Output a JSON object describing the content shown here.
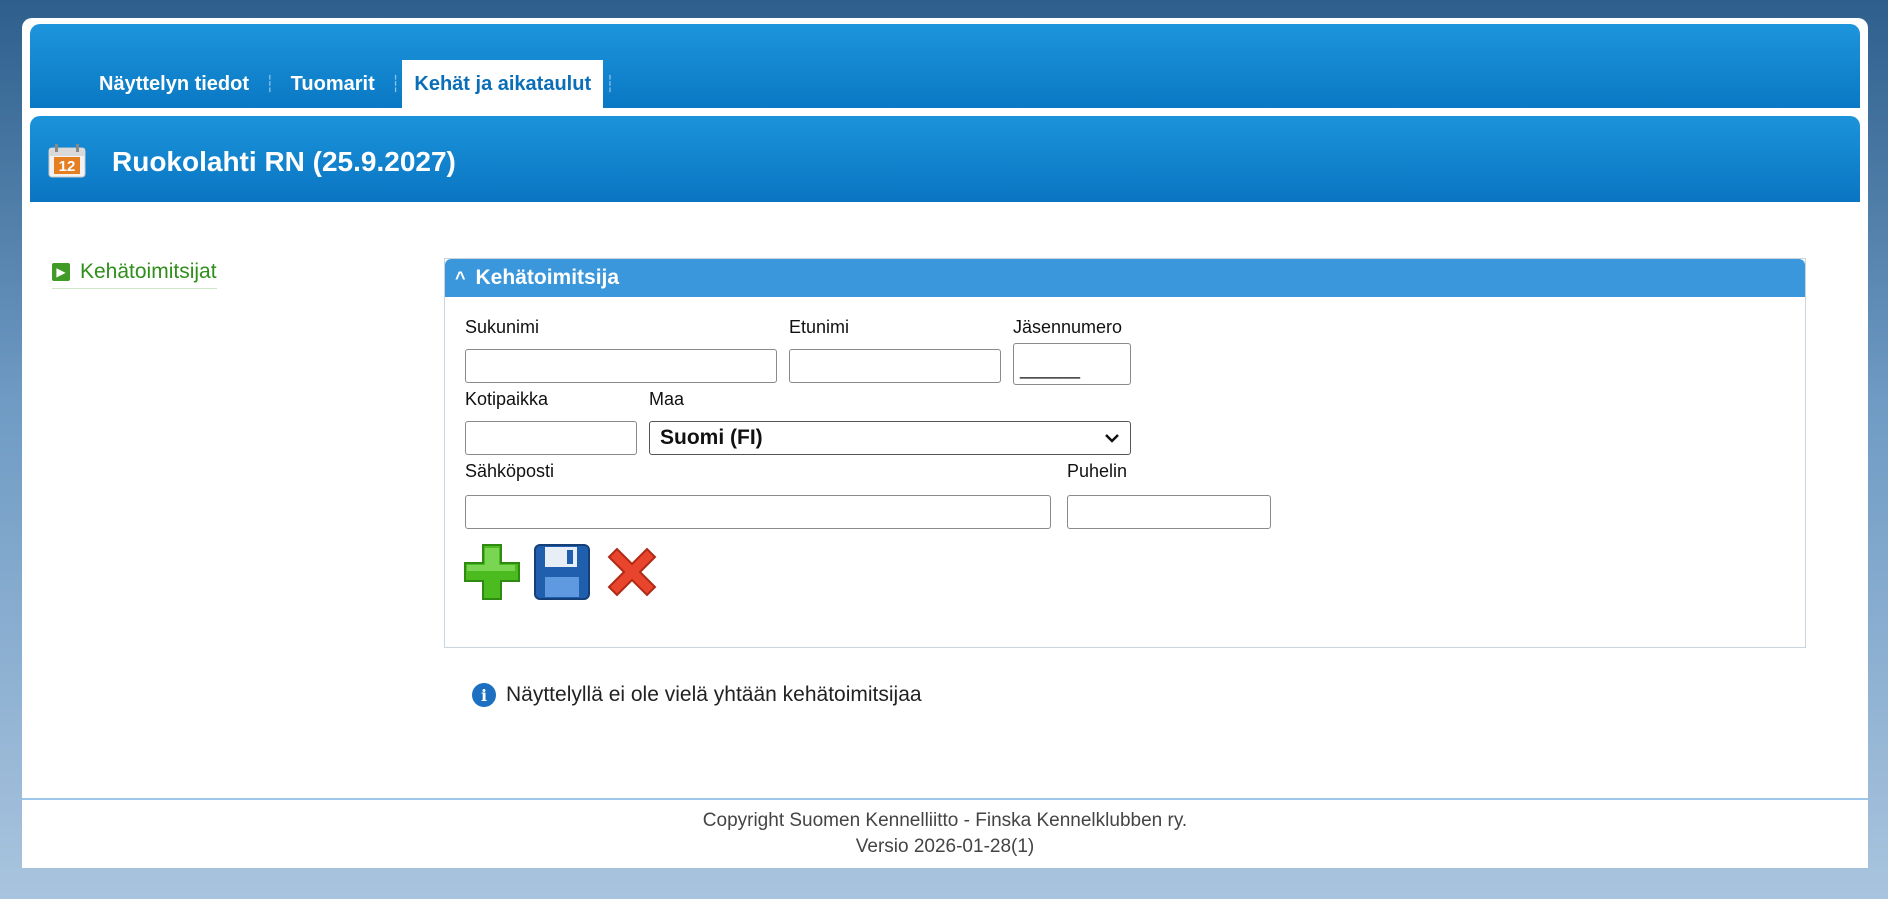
{
  "tabs": [
    {
      "label": "Näyttelyn tiedot",
      "active": false
    },
    {
      "label": "Tuomarit",
      "active": false
    },
    {
      "label": "Kehät ja aikataulut",
      "active": true
    }
  ],
  "header": {
    "title": "Ruokolahti RN (25.9.2027)",
    "calendar_icon_text": "12"
  },
  "sidebar": {
    "items": [
      {
        "label": "Kehätoimitsijat"
      }
    ]
  },
  "panel": {
    "title": "Kehätoimitsija",
    "fields": {
      "sukunimi": {
        "label": "Sukunimi",
        "value": ""
      },
      "etunimi": {
        "label": "Etunimi",
        "value": ""
      },
      "jasennumero": {
        "label": "Jäsennumero",
        "value": "______"
      },
      "kotipaikka": {
        "label": "Kotipaikka",
        "value": ""
      },
      "maa": {
        "label": "Maa",
        "value": "Suomi (FI)"
      },
      "sahkoposti": {
        "label": "Sähköposti",
        "value": ""
      },
      "puhelin": {
        "label": "Puhelin",
        "value": ""
      }
    },
    "actions": [
      "add-icon",
      "save-icon",
      "delete-icon"
    ]
  },
  "info": {
    "message": "Näyttelyllä ei ole vielä yhtään kehätoimitsijaa"
  },
  "footer": {
    "copyright": "Copyright Suomen Kennelliitto - Finska Kennelklubben ry.",
    "version": "Versio 2026-01-28(1)"
  },
  "colors": {
    "header_blue": "#0a78c4",
    "panel_header": "#3b97dc",
    "sidebar_green": "#3f9b25"
  }
}
